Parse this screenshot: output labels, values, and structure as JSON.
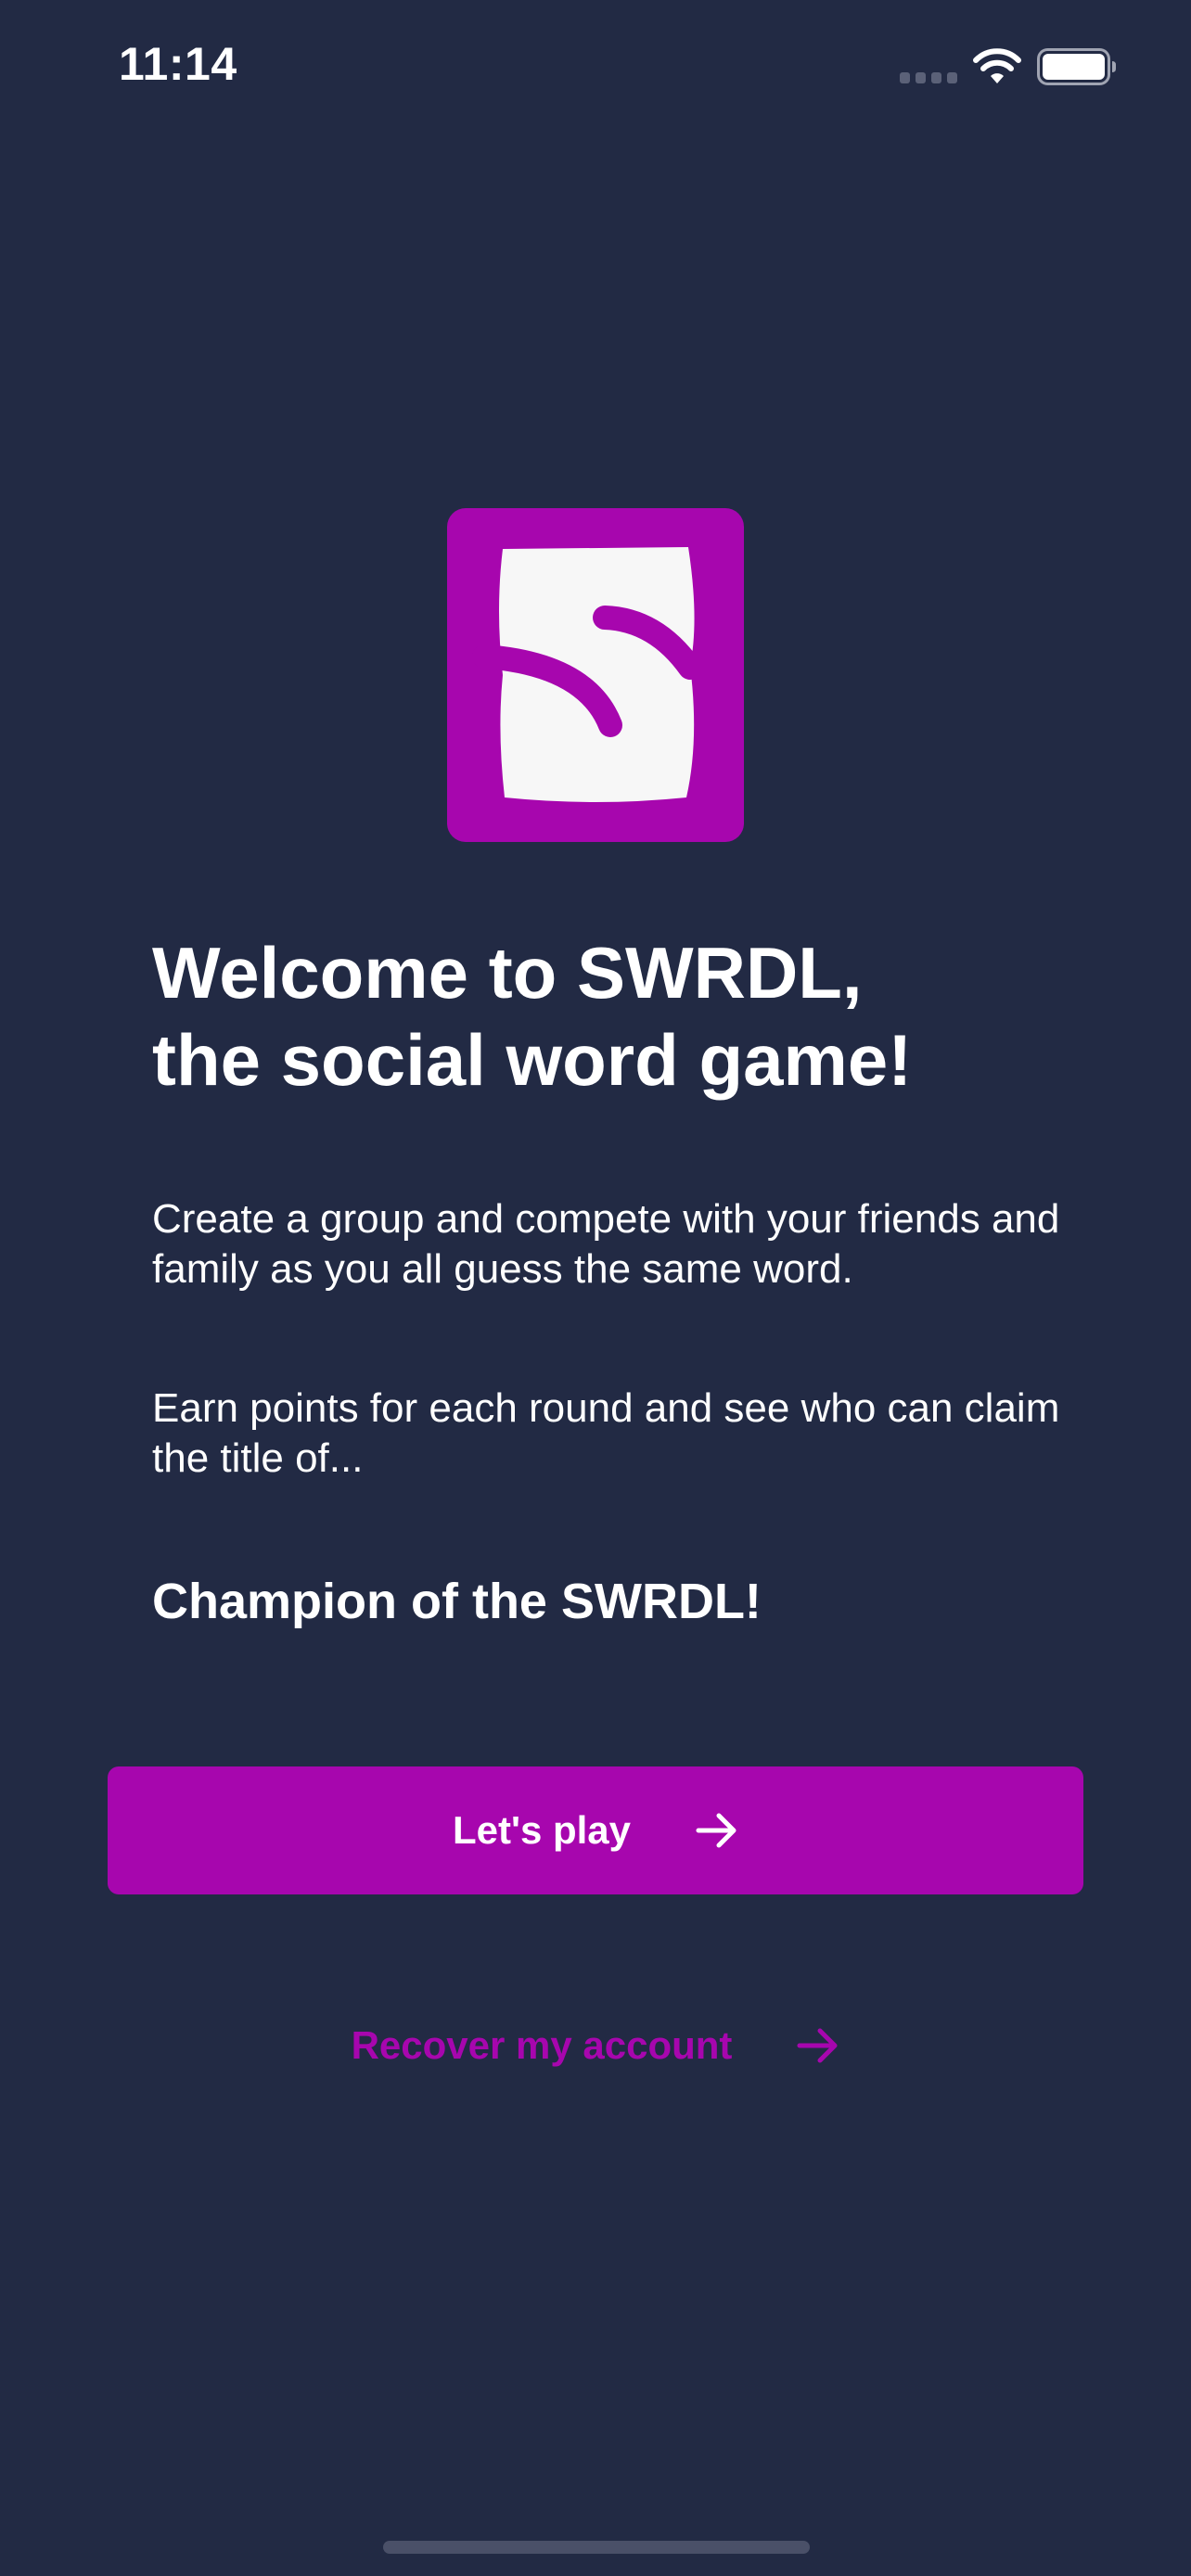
{
  "status_bar": {
    "time": "11:14"
  },
  "icons": {
    "signal": "cellular-signal-icon",
    "wifi": "wifi-icon",
    "battery": "battery-icon",
    "logo": "swrdl-logo",
    "arrow": "arrow-right-icon"
  },
  "welcome": {
    "title_line1": "Welcome to SWRDL,",
    "title_line2": "the social word game!",
    "paragraph1": "Create a group and compete with your friends and family as you all guess the same word.",
    "paragraph2": "Earn points for each round and see who can claim the title of...",
    "champion": "Champion of the SWRDL!"
  },
  "actions": {
    "primary_label": "Let's play",
    "secondary_label": "Recover my account"
  },
  "colors": {
    "background": "#222A44",
    "accent": "#A706AE",
    "card": "#F7F7F7",
    "text": "#FFFFFF"
  }
}
